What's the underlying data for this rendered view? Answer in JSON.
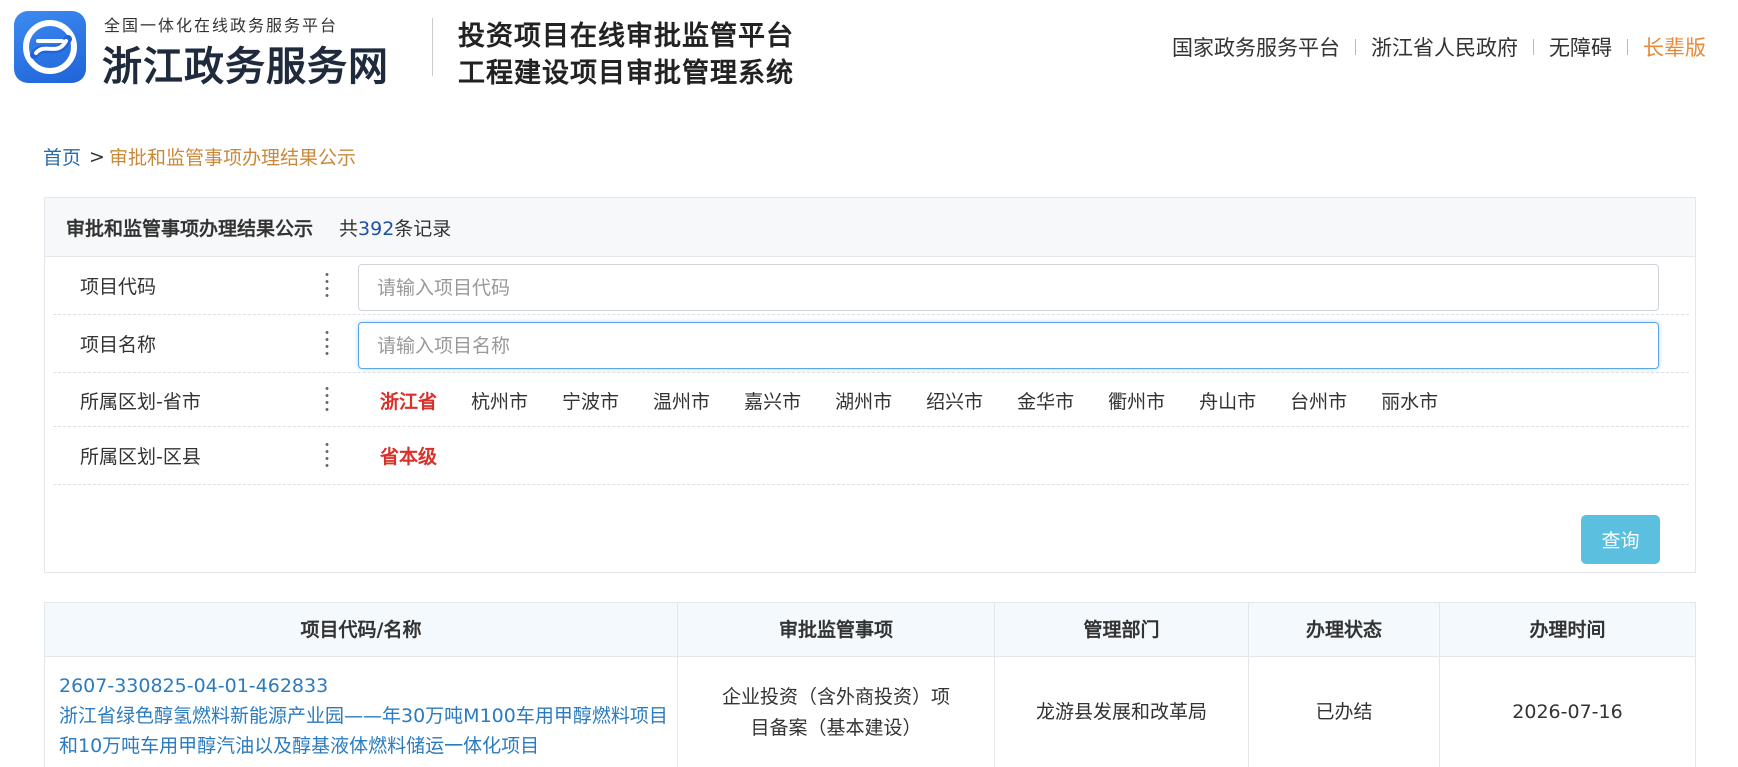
{
  "header": {
    "brand_sub": "全国一体化在线政务服务平台",
    "brand_main": "浙江政务服务网",
    "system_title_1": "投资项目在线审批监管平台",
    "system_title_2": "工程建设项目审批管理系统",
    "links": [
      "国家政务服务平台",
      "浙江省人民政府",
      "无障碍"
    ],
    "elder_link": "长辈版",
    "accent_color": "#e8893a"
  },
  "breadcrumb": {
    "home": "首页",
    "separator": ">",
    "current": "审批和监管事项办理结果公示"
  },
  "panel": {
    "title": "审批和监管事项办理结果公示",
    "count_prefix": "共",
    "count": "392",
    "count_suffix": "条记录"
  },
  "filters": {
    "code_label": "项目代码",
    "code_placeholder": "请输入项目代码",
    "name_label": "项目名称",
    "name_placeholder": "请输入项目名称",
    "city_label": "所属区划-省市",
    "cities": [
      "浙江省",
      "杭州市",
      "宁波市",
      "温州市",
      "嘉兴市",
      "湖州市",
      "绍兴市",
      "金华市",
      "衢州市",
      "舟山市",
      "台州市",
      "丽水市"
    ],
    "city_selected": "浙江省",
    "county_label": "所属区划-区县",
    "county_selected": "省本级",
    "active_color": "#d9302a"
  },
  "query_button": "查询",
  "table": {
    "headers": [
      "项目代码/名称",
      "审批监管事项",
      "管理部门",
      "办理状态",
      "办理时间"
    ],
    "rows": [
      {
        "code": "2607-330825-04-01-462833",
        "name": "浙江省绿色醇氢燃料新能源产业园——年30万吨M100车用甲醇燃料项目和10万吨车用甲醇汽油以及醇基液体燃料储运一体化项目",
        "item": "企业投资（含外商投资）项目备案（基本建设）",
        "department": "龙游县发展和改革局",
        "status": "已办结",
        "date": "2026-07-16"
      }
    ]
  }
}
